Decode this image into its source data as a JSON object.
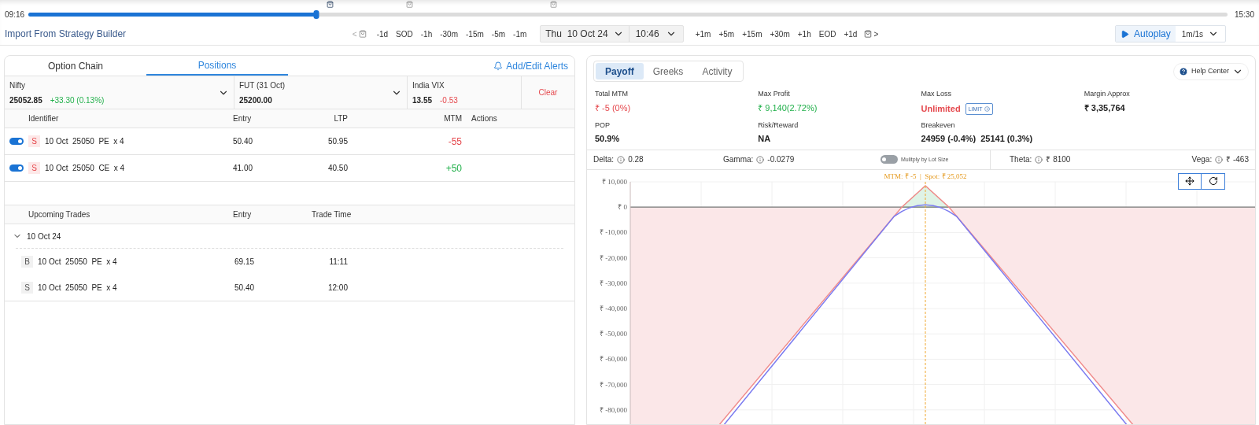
{
  "timeline": {
    "start": "09:16",
    "end": "15:30",
    "level": 0.24
  },
  "toolbar": {
    "import_link": "Import From Strategy Builder",
    "prev_marker": "<",
    "back_steps": [
      "-1d",
      "SOD",
      "-1h",
      "-30m",
      "-15m",
      "-5m",
      "-1m"
    ],
    "date": "Thu  10 Oct 24",
    "time": "10:46",
    "forward_steps": [
      "+1m",
      "+5m",
      "+15m",
      "+30m",
      "+1h",
      "EOD",
      "+1d"
    ],
    "next_marker": ">",
    "autoplay": "Autoplay",
    "speed": "1m/1s"
  },
  "left_panel": {
    "tabs": [
      {
        "label": "Option Chain",
        "selected": false
      },
      {
        "label": "Positions",
        "selected": true
      }
    ],
    "alerts_link": "Add/Edit Alerts",
    "quotes": [
      {
        "name": "Nifty",
        "value": "25052.85",
        "change": "+33.30 (0.13%)",
        "color": "#22b04b",
        "dropdown": true
      },
      {
        "name": "FUT (31 Oct)",
        "value": "25200.00",
        "dropdown": true
      },
      {
        "name": "India VIX",
        "value": "13.55",
        "change": "-0.53",
        "color": "#e5484d",
        "dropdown": false
      }
    ],
    "clear_button": "Clear",
    "positions": {
      "columns": [
        "Identifier",
        "Entry",
        "LTP",
        "MTM",
        "Actions"
      ],
      "rows": [
        {
          "enabled": true,
          "side": "S",
          "expiry": "10 Oct",
          "strike": "25050",
          "type": "PE",
          "qty": "x 4",
          "entry": "50.40",
          "ltp": "50.95",
          "mtm": "-55",
          "color": "#e5484d"
        },
        {
          "enabled": true,
          "side": "S",
          "expiry": "10 Oct",
          "strike": "25050",
          "type": "CE",
          "qty": "x 4",
          "entry": "41.00",
          "ltp": "40.50",
          "mtm": "+50",
          "color": "#22b04b"
        }
      ]
    },
    "upcoming": {
      "columns": [
        "Upcoming Trades",
        "Entry",
        "Trade Time"
      ],
      "groups": [
        {
          "label": "10 Oct 24",
          "expanded": true,
          "trades": [
            {
              "side": "B",
              "expiry": "10 Oct",
              "strike": "25050",
              "type": "PE",
              "qty": "x 4",
              "entry": "69.15",
              "time": "11:11"
            },
            {
              "side": "S",
              "expiry": "10 Oct",
              "strike": "25050",
              "type": "PE",
              "qty": "x 4",
              "entry": "50.40",
              "time": "12:00"
            }
          ]
        }
      ]
    }
  },
  "right_panel": {
    "tabs": [
      {
        "label": "Payoff",
        "selected": true
      },
      {
        "label": "Greeks",
        "selected": false
      },
      {
        "label": "Activity",
        "selected": false
      }
    ],
    "help_center": "Help Center",
    "stats": [
      {
        "label": "Total MTM",
        "values": [
          "₹ -5 (0%)"
        ],
        "color": "#e5484d",
        "bold": false
      },
      {
        "label": "Max Profit",
        "values": [
          "₹ 9,140(2.72%)"
        ],
        "color": "#22b04b",
        "bold": false
      },
      {
        "label": "Max Loss",
        "values": [
          "Unlimited"
        ],
        "color": "#e5484d",
        "bold": true,
        "badge": "LIMIT"
      },
      {
        "label": "Margin Approx",
        "values": [
          "₹ 3,35,764"
        ],
        "color": "#222222",
        "bold": true
      },
      {
        "label": "POP",
        "values": [
          "50.9%"
        ],
        "color": "#222222",
        "bold": true
      },
      {
        "label": "Risk/Reward",
        "values": [
          "NA"
        ],
        "color": "#222222",
        "bold": true
      },
      {
        "label": "Breakeven",
        "values": [
          "24959 (-0.4%)",
          "25141 (0.3%)"
        ],
        "color": "#222222",
        "bold": true
      }
    ],
    "greeks": [
      {
        "label": "Delta:",
        "value": "0.28"
      },
      {
        "label": "Gamma:",
        "value": "-0.0279"
      },
      {
        "label": "Theta:",
        "value": "₹ 8100"
      },
      {
        "label": "Vega:",
        "value": "₹ -463"
      }
    ],
    "lot_size_toggle": {
      "label": "Mulitply by Lot Size",
      "on": false
    },
    "chart": {
      "y_labels": [
        "₹ 10,000",
        "₹ 0",
        "₹ -10,000",
        "₹ -20,000",
        "₹ -30,000",
        "₹ -40,000",
        "₹ -50,000",
        "₹ -60,000",
        "₹ -70,000",
        "₹ -80,000"
      ],
      "marker_label": "MTM: ₹ -5  |  Spot: ₹ 25,052"
    }
  }
}
